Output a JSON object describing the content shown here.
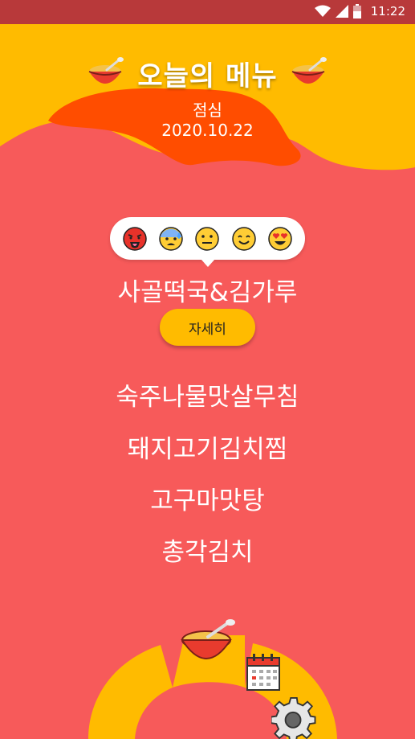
{
  "status_bar": {
    "time": "11:22"
  },
  "header": {
    "title": "오늘의 메뉴",
    "meal": "점심",
    "date": "2020.10.22"
  },
  "reactions": [
    "tongue-out-angry-icon",
    "anxious-sweat-icon",
    "neutral-face-icon",
    "smiling-face-icon",
    "heart-eyes-icon"
  ],
  "menu": {
    "items": [
      "사골떡국&김가루",
      "숙주나물맛살무침",
      "돼지고기김치찜",
      "고구마맛탕",
      "총각김치"
    ],
    "detail_button": "자세히"
  },
  "colors": {
    "background": "#f75a5a",
    "accent_yellow": "#ffbb00",
    "accent_orange": "#ff4d00",
    "status_bar": "#b8393a"
  }
}
